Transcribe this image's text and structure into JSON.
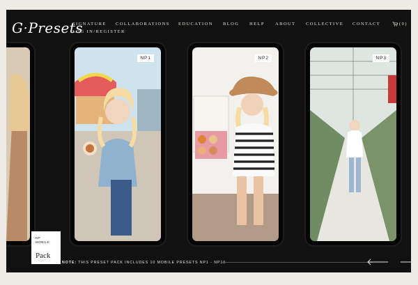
{
  "brand": {
    "logo_text": "G·Presets"
  },
  "nav": {
    "items": [
      "SIGNATURE",
      "COLLABORATIONS",
      "EDUCATION",
      "BLOG",
      "HELP",
      "ABOUT",
      "COLLECTIVE",
      "CONTACT"
    ],
    "cart_label": "(0)",
    "account_label": "LOG IN/REGISTER"
  },
  "phones": [
    {
      "badge": "",
      "photo": "partial-left-crop"
    },
    {
      "badge": "NP1",
      "photo": "woman-at-carnival-holding-food"
    },
    {
      "badge": "NP2",
      "photo": "woman-in-sunhat-holding-donut-box"
    },
    {
      "badge": "NP3",
      "photo": "woman-in-greenhouse"
    },
    {
      "badge": "",
      "photo": "partial-right-crop"
    }
  ],
  "pack_card": {
    "top_lines": [
      "NP",
      "MOBILE"
    ],
    "title": "Pack"
  },
  "footer": {
    "note_prefix": "NOTE:",
    "note_text": "THIS PRESET PACK INCLUDES 10 MOBILE PRESETS NP1 - NP10"
  },
  "colors": {
    "frame_bg": "#111111",
    "page_bg": "#efece7",
    "text_light": "#e8e3da"
  }
}
